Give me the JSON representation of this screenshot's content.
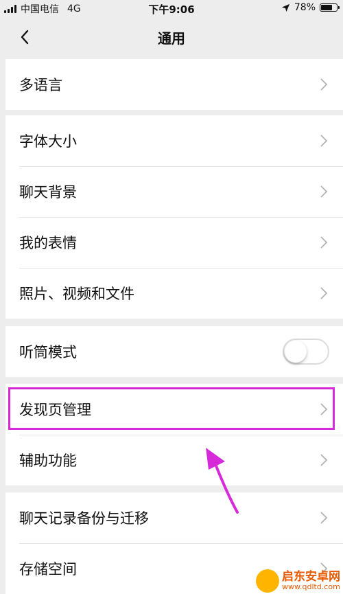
{
  "status_bar": {
    "carrier": "中国电信",
    "network": "4G",
    "time": "下午9:06",
    "battery": "78%",
    "battery_level": 0.78
  },
  "nav": {
    "title": "通用",
    "back_icon": "chevron-left-icon"
  },
  "groups": [
    {
      "items": [
        {
          "label": "多语言"
        }
      ]
    },
    {
      "items": [
        {
          "label": "字体大小"
        },
        {
          "label": "聊天背景"
        },
        {
          "label": "我的表情"
        },
        {
          "label": "照片、视频和文件"
        }
      ]
    },
    {
      "items": [
        {
          "label": "听筒模式",
          "toggle": false
        }
      ]
    },
    {
      "items": [
        {
          "label": "发现页管理"
        },
        {
          "label": "辅助功能"
        }
      ]
    },
    {
      "items": [
        {
          "label": "聊天记录备份与迁移"
        },
        {
          "label": "存储空间"
        }
      ]
    }
  ],
  "watermark": {
    "name": "启东安卓网",
    "url": "www.qdltd.com"
  },
  "colors": {
    "background": "#ededed",
    "highlight": "#d62ad9"
  }
}
